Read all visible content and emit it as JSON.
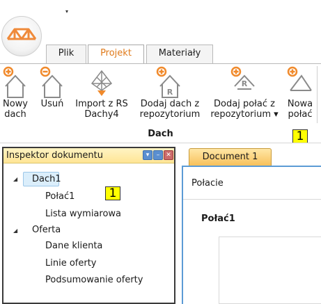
{
  "quick_access": {
    "arrow": "▾"
  },
  "tabs": [
    {
      "label": "Plik"
    },
    {
      "label": "Projekt"
    },
    {
      "label": "Materiały"
    }
  ],
  "ribbon": {
    "buttons": [
      {
        "line1": "Nowy",
        "line2": "dach",
        "icon": "house-add-icon"
      },
      {
        "line1": "Usuń",
        "line2": "",
        "icon": "house-remove-icon"
      },
      {
        "line1": "Import z RS",
        "line2": "Dachy4",
        "icon": "roof-import-icon"
      },
      {
        "line1": "Dodaj dach z",
        "line2": "repozytorium",
        "icon": "house-repository-add-icon"
      },
      {
        "line1": "Dodaj połać z",
        "line2": "repozytorium ▾",
        "icon": "roof-slope-repository-add-icon"
      },
      {
        "line1": "Nowa",
        "line2": "połać",
        "icon": "roof-slope-add-icon"
      }
    ],
    "group_label": "Dach",
    "badge": "1"
  },
  "inspector": {
    "title": "Inspektor dokumentu",
    "buttons": {
      "dropdown": "▾",
      "minimize": "–",
      "close": "✕"
    },
    "tree": {
      "dach1": "Dach1",
      "polac1": "Połać1",
      "lista": "Lista wymiarowa",
      "oferta": "Oferta",
      "dane": "Dane klienta",
      "linie": "Linie oferty",
      "podsumowanie": "Podsumowanie oferty"
    },
    "expander": "◢",
    "badge": "1"
  },
  "document": {
    "tab_label": "Document 1",
    "header": "Połacie",
    "section_title": "Połać1"
  },
  "colors": {
    "accent_orange": "#e07a1a",
    "badge_yellow": "#ffff00",
    "doc_border_blue": "#5b9bd5"
  }
}
